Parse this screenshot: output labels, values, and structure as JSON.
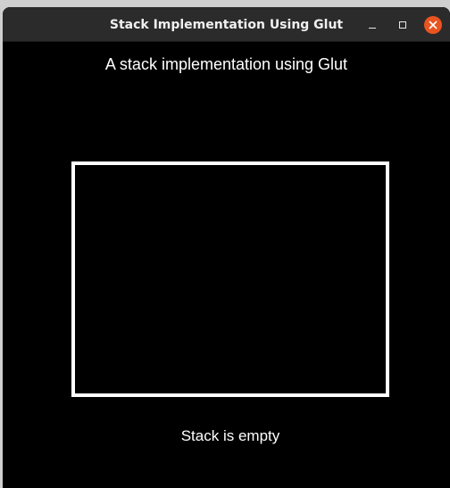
{
  "window": {
    "title": "Stack Implementation Using Glut",
    "close_color": "#e95420",
    "titlebar_color": "#2b2b2b"
  },
  "controls": {
    "minimize_icon": "minimize-icon",
    "maximize_icon": "maximize-icon",
    "close_icon": "close-icon"
  },
  "canvas": {
    "background": "#000000",
    "heading": "A stack implementation using Glut",
    "status": "Stack is empty",
    "stack_items": []
  }
}
